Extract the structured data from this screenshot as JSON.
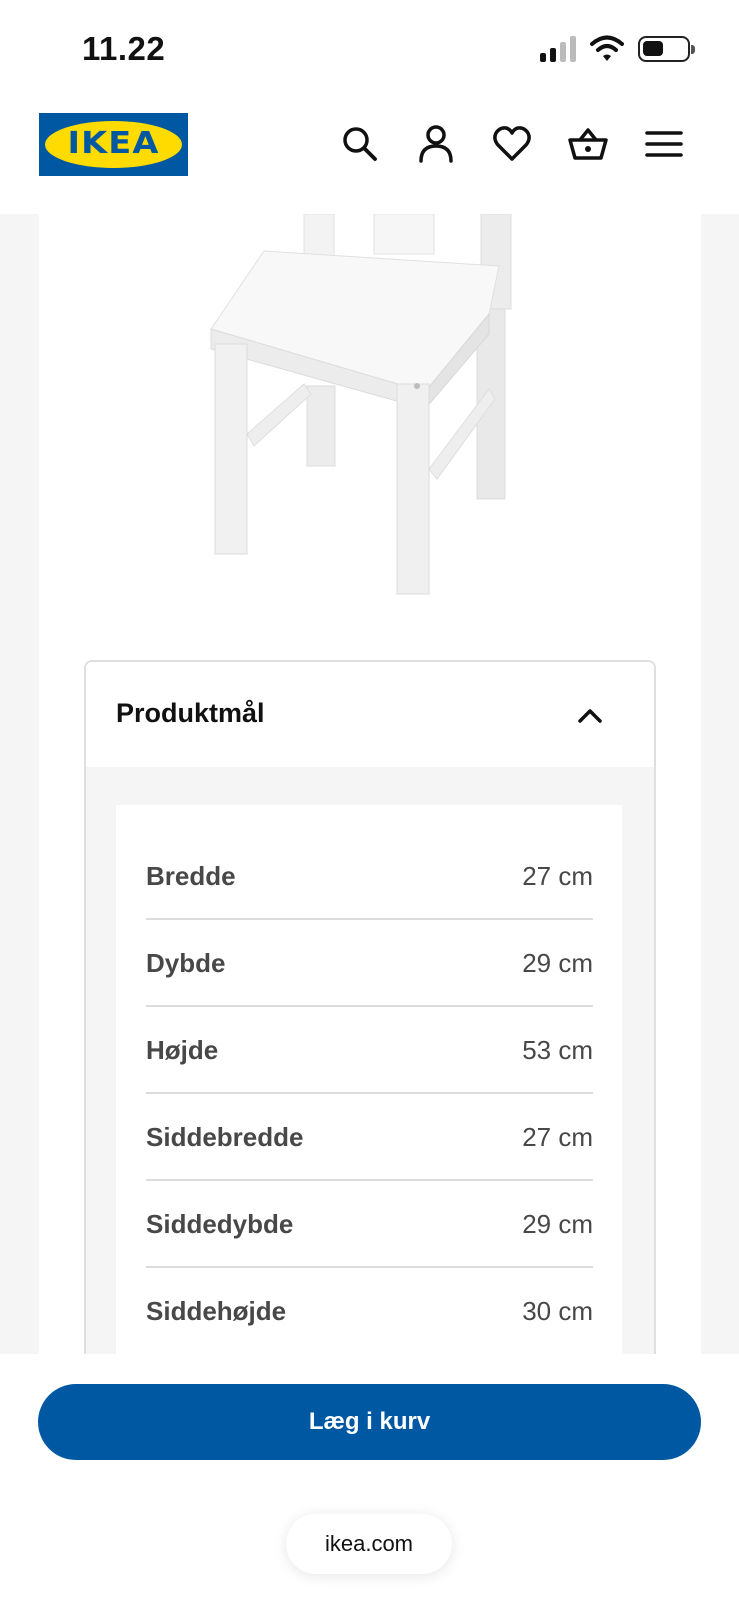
{
  "status_bar": {
    "time": "11.22",
    "icons": [
      "signal-icon",
      "wifi-icon",
      "battery-icon"
    ]
  },
  "header": {
    "logo_text": "IKEA",
    "icons": [
      "search-icon",
      "account-icon",
      "heart-icon",
      "basket-icon",
      "menu-icon"
    ]
  },
  "product_dimensions": {
    "title": "Produktmål",
    "expanded": true,
    "rows": [
      {
        "label": "Bredde",
        "value": "27 cm"
      },
      {
        "label": "Dybde",
        "value": "29 cm"
      },
      {
        "label": "Højde",
        "value": "53 cm"
      },
      {
        "label": "Siddebredde",
        "value": "27 cm"
      },
      {
        "label": "Siddedybde",
        "value": "29 cm"
      },
      {
        "label": "Siddehøjde",
        "value": "30 cm"
      }
    ]
  },
  "actions": {
    "add_to_cart_label": "Læg i kurv"
  },
  "browser": {
    "url": "ikea.com"
  },
  "colors": {
    "brand_blue": "#0058a3",
    "brand_yellow": "#ffdb00",
    "page_bg": "#f5f5f5"
  }
}
